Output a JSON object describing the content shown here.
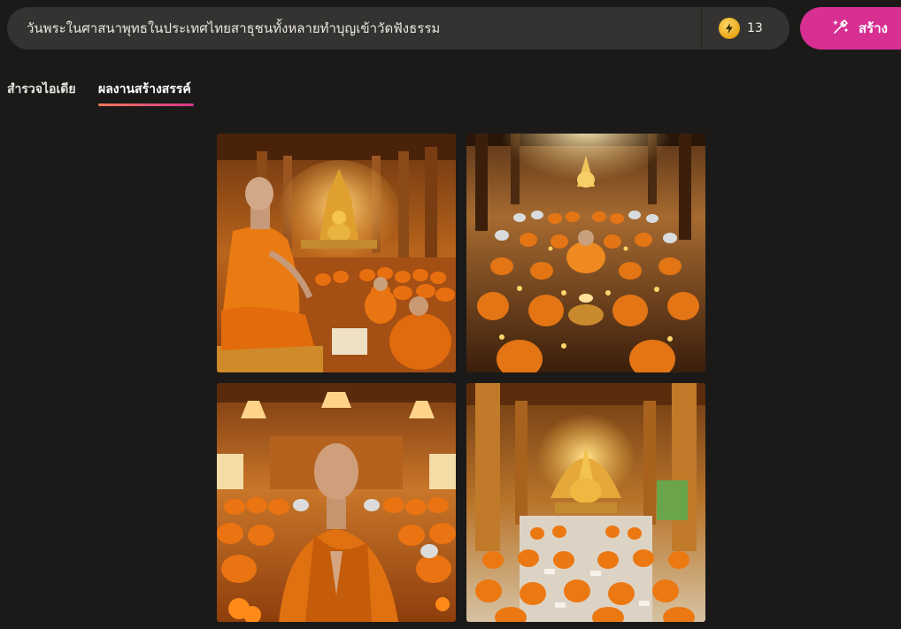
{
  "header": {
    "prompt": "วันพระในศาสนาพุทธในประเทศไทยสาธุชนทั้งหลายทำบุญเข้าวัดฟังธรรม",
    "credits": "13",
    "credit_icon": "coin-bolt-icon",
    "create_label": "สร้าง",
    "create_icon": "wand-icon"
  },
  "tabs": [
    {
      "label": "สำรวจไอเดีย",
      "active": false
    },
    {
      "label": "ผลงานสร้างสรรค์",
      "active": true
    }
  ],
  "colors": {
    "background": "#1b1a19",
    "prompt_box": "#343331",
    "create_button": "#d72f92",
    "tab_underline_start": "#f2795a",
    "tab_underline_end": "#d7358c"
  },
  "gallery": {
    "images": [
      {
        "subject": "seated-monk-in-temple-hall"
      },
      {
        "subject": "crowd-of-monks-with-candles"
      },
      {
        "subject": "monk-praying-foreground"
      },
      {
        "subject": "golden-temple-interior-with-buddha"
      }
    ]
  }
}
